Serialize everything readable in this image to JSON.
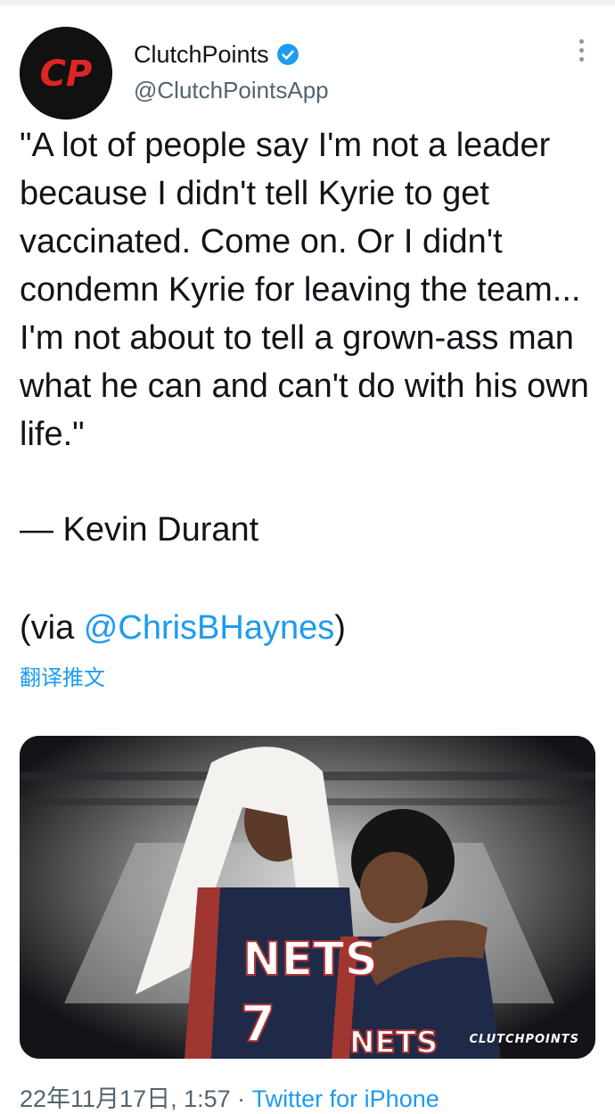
{
  "author": {
    "display_name": "ClutchPoints",
    "handle": "@ClutchPointsApp",
    "avatar_text": "CP",
    "verified": true
  },
  "tweet": {
    "body": "\"A lot of people say I'm not a leader because I didn't tell Kyrie to get vaccinated. Come on. Or I didn't condemn Kyrie for leaving the team... I'm not about to tell a grown-ass man what he can and can't do with his own life.\"",
    "attribution": "— Kevin Durant",
    "via_prefix": "(via ",
    "via_mention": "@ChrisBHaynes",
    "via_suffix": ")",
    "translate_label": "翻译推文"
  },
  "media": {
    "watermark": "CLUTCHPOINTS",
    "jersey_left_text": "NETS",
    "jersey_left_number": "7",
    "jersey_right_text": "NETS"
  },
  "meta": {
    "timestamp": "22年11月17日, 1:57",
    "separator": " · ",
    "source": "Twitter for iPhone"
  },
  "colors": {
    "link": "#1d9bf0",
    "muted": "#536471",
    "brand_red": "#e02424"
  }
}
